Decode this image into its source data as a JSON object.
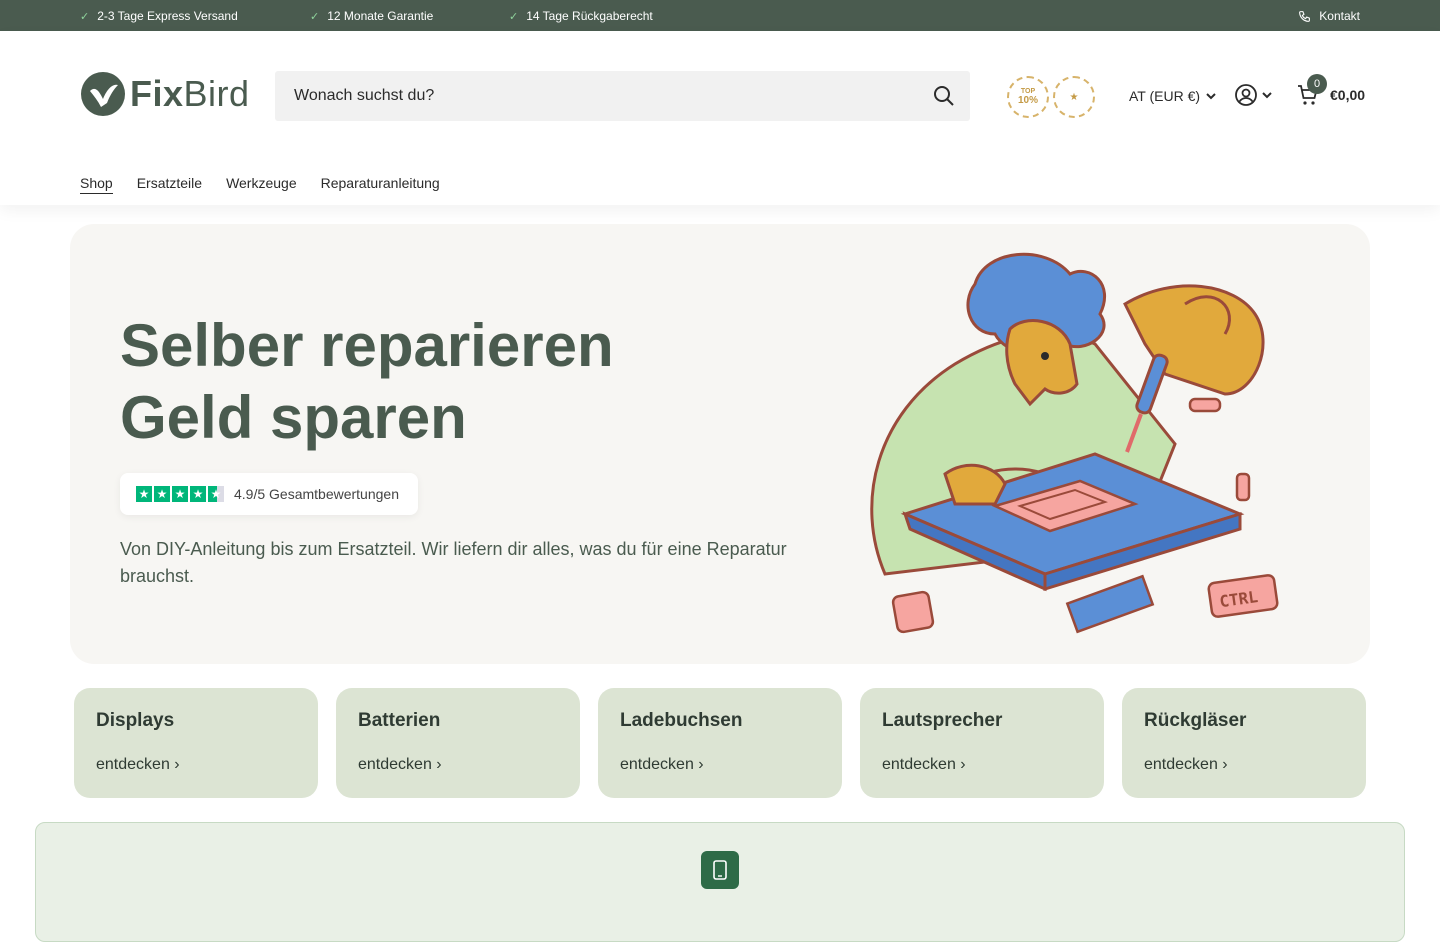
{
  "topbar": {
    "usps": [
      "2-3 Tage Express Versand",
      "12 Monate Garantie",
      "14 Tage Rückgaberecht"
    ],
    "contact": "Kontakt"
  },
  "header": {
    "logo_text_bold": "Fix",
    "logo_text_light": "Bird",
    "search_placeholder": "Wonach suchst du?",
    "badge1_top": "TOP",
    "badge1_big": "10%",
    "locale": "AT (EUR €)",
    "cart_count": "0",
    "cart_total": "€0,00"
  },
  "nav": {
    "items": [
      "Shop",
      "Ersatzteile",
      "Werkzeuge",
      "Reparaturanleitung"
    ],
    "active": "Shop"
  },
  "hero": {
    "title_line1": "Selber reparieren",
    "title_line2": "Geld sparen",
    "rating_text": "4.9/5 Gesamtbewertungen",
    "rating_value": 4.9,
    "description": "Von DIY-Anleitung bis zum Ersatzteil. Wir liefern dir alles, was du für eine Reparatur brauchst."
  },
  "categories": [
    {
      "title": "Displays",
      "link": "entdecken ›"
    },
    {
      "title": "Batterien",
      "link": "entdecken ›"
    },
    {
      "title": "Ladebuchsen",
      "link": "entdecken ›"
    },
    {
      "title": "Lautsprecher",
      "link": "entdecken ›"
    },
    {
      "title": "Rückgläser",
      "link": "entdecken ›"
    }
  ],
  "colors": {
    "brand": "#4a5b4f",
    "category_bg": "#dce4d3",
    "trustpilot": "#00b67a",
    "promo_icon": "#2e6b47"
  },
  "icons": [
    "check-icon",
    "phone-icon",
    "bird-logo-icon",
    "search-icon",
    "user-icon",
    "chevron-down-icon",
    "cart-icon",
    "smartphone-icon"
  ]
}
